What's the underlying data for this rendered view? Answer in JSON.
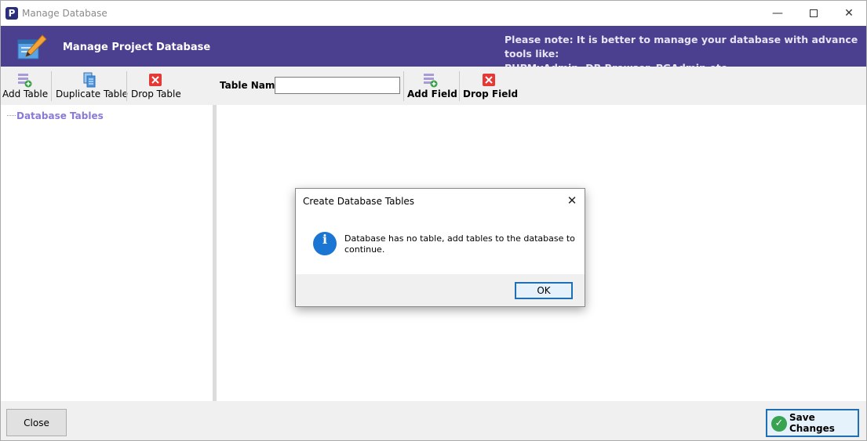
{
  "window": {
    "title": "Manage Database",
    "app_icon_letter": "P"
  },
  "banner": {
    "title": "Manage Project Database",
    "note": "Please note: It is better to manage your database with advance tools like:\nPHPMyAdmin, DB Browser, PGAdmin etc..",
    "color": "#4b3f8f"
  },
  "left_toolbar": {
    "add_table": "Add Table",
    "duplicate_table": "Duplicate Table",
    "drop_table": "Drop Table"
  },
  "right_toolbar": {
    "table_name_label": "Table Name",
    "table_name_value": "",
    "add_field": "Add Field",
    "drop_field": "Drop Field"
  },
  "tree": {
    "root": "Database Tables"
  },
  "footer": {
    "close": "Close",
    "save": "Save Changes"
  },
  "dialog": {
    "title": "Create Database Tables",
    "message": "Database has no table, add tables to the database to continue.",
    "ok": "OK",
    "icon": "info-icon"
  }
}
